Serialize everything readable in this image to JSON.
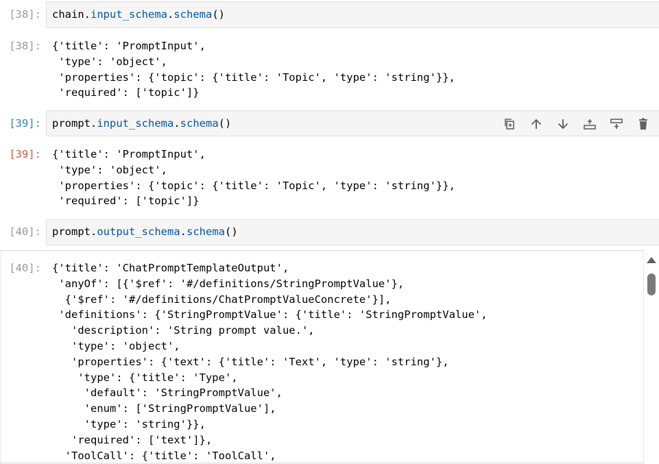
{
  "cells": [
    {
      "in_prompt": "[38]:",
      "code": {
        "obj": "chain",
        "attr1": "input_schema",
        "attr2": "schema",
        "tail": "()"
      },
      "out_prompt": "[38]:",
      "output_lines": [
        "{'title': 'PromptInput',",
        " 'type': 'object',",
        " 'properties': {'topic': {'title': 'Topic', 'type': 'string'}},",
        " 'required': ['topic']}"
      ]
    },
    {
      "in_prompt": "[39]:",
      "code": {
        "obj": "prompt",
        "attr1": "input_schema",
        "attr2": "schema",
        "tail": "()"
      },
      "out_prompt": "[39]:",
      "output_lines": [
        "{'title': 'PromptInput',",
        " 'type': 'object',",
        " 'properties': {'topic': {'title': 'Topic', 'type': 'string'}},",
        " 'required': ['topic']}"
      ]
    },
    {
      "in_prompt": "[40]:",
      "code": {
        "obj": "prompt",
        "attr1": "output_schema",
        "attr2": "schema",
        "tail": "()"
      },
      "out_prompt": "[40]:",
      "output_lines": [
        "{'title': 'ChatPromptTemplateOutput',",
        " 'anyOf': [{'$ref': '#/definitions/StringPromptValue'},",
        "  {'$ref': '#/definitions/ChatPromptValueConcrete'}],",
        " 'definitions': {'StringPromptValue': {'title': 'StringPromptValue',",
        "   'description': 'String prompt value.',",
        "   'type': 'object',",
        "   'properties': {'text': {'title': 'Text', 'type': 'string'},",
        "    'type': {'title': 'Type',",
        "     'default': 'StringPromptValue',",
        "     'enum': ['StringPromptValue'],",
        "     'type': 'string'}},",
        "   'required': ['text']},",
        "  'ToolCall': {'title': 'ToolCall',"
      ]
    }
  ],
  "toolbar": {
    "icons": [
      "duplicate-icon",
      "move-up-icon",
      "move-down-icon",
      "insert-above-icon",
      "insert-below-icon",
      "delete-icon"
    ]
  },
  "colors": {
    "active_in_prompt": "#307fc1",
    "active_out_prompt": "#bf5b3d",
    "code_attr": "#0055aa"
  }
}
